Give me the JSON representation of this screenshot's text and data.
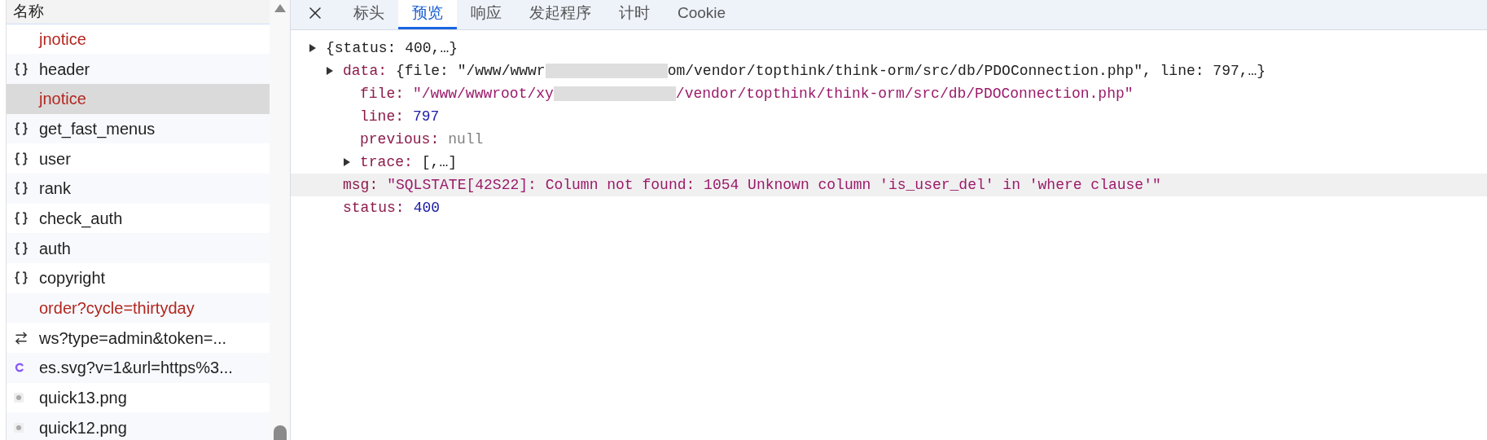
{
  "request_list": {
    "header": "名称",
    "rows": [
      {
        "name": "jnotice",
        "kind": "none",
        "failed": true,
        "selected": false
      },
      {
        "name": "header",
        "kind": "json",
        "failed": false,
        "selected": false
      },
      {
        "name": "jnotice",
        "kind": "none",
        "failed": true,
        "selected": true
      },
      {
        "name": "get_fast_menus",
        "kind": "json",
        "failed": false,
        "selected": false
      },
      {
        "name": "user",
        "kind": "json",
        "failed": false,
        "selected": false
      },
      {
        "name": "rank",
        "kind": "json",
        "failed": false,
        "selected": false
      },
      {
        "name": "check_auth",
        "kind": "json",
        "failed": false,
        "selected": false
      },
      {
        "name": "auth",
        "kind": "json",
        "failed": false,
        "selected": false
      },
      {
        "name": "copyright",
        "kind": "json",
        "failed": false,
        "selected": false
      },
      {
        "name": "order?cycle=thirtyday",
        "kind": "none",
        "failed": true,
        "selected": false
      },
      {
        "name": "ws?type=admin&token=...",
        "kind": "websocket",
        "failed": false,
        "selected": false
      },
      {
        "name": "es.svg?v=1&url=https%3...",
        "kind": "stylesheet",
        "failed": false,
        "selected": false
      },
      {
        "name": "quick13.png",
        "kind": "image",
        "failed": false,
        "selected": false
      },
      {
        "name": "quick12.png",
        "kind": "image",
        "failed": false,
        "selected": false
      }
    ]
  },
  "tabs": [
    {
      "label": "标头",
      "selected": false
    },
    {
      "label": "预览",
      "selected": true
    },
    {
      "label": "响应",
      "selected": false
    },
    {
      "label": "发起程序",
      "selected": false
    },
    {
      "label": "计时",
      "selected": false
    },
    {
      "label": "Cookie",
      "selected": false
    }
  ],
  "preview": {
    "tree": [
      {
        "kind": "object",
        "value_parts": [
          "{status: 400,…}"
        ],
        "toggle": true,
        "highlighted": false,
        "children": [
          {
            "key": "data:",
            "kind": "object",
            "value_parts": [
              "{file: \"/www/wwwr",
              "om/vendor/topthink/think-orm/src/db/PDOConnection.php\", line: 797,…}"
            ],
            "toggle": true,
            "highlighted": false,
            "children": [
              {
                "key": "file:",
                "kind": "string",
                "value_parts": [
                  "\"/www/wwwroot/xy",
                  "/vendor/topthink/think-orm/src/db/PDOConnection.php\""
                ],
                "toggle": false,
                "highlighted": false
              },
              {
                "key": "line:",
                "kind": "number",
                "value_parts": [
                  "797"
                ],
                "toggle": false,
                "highlighted": false
              },
              {
                "key": "previous:",
                "kind": "null",
                "value_parts": [
                  "null"
                ],
                "toggle": false,
                "highlighted": false
              },
              {
                "key": "trace:",
                "kind": "object",
                "value_parts": [
                  "[,…]"
                ],
                "toggle": true,
                "highlighted": false
              }
            ]
          },
          {
            "key": "msg:",
            "kind": "string",
            "value_parts": [
              "\"SQLSTATE[42S22]: Column not found: 1054 Unknown column 'is_user_del' in 'where clause'\""
            ],
            "toggle": false,
            "highlighted": true
          },
          {
            "key": "status:",
            "kind": "number",
            "value_parts": [
              "400"
            ],
            "toggle": false,
            "highlighted": false
          }
        ]
      }
    ]
  }
}
